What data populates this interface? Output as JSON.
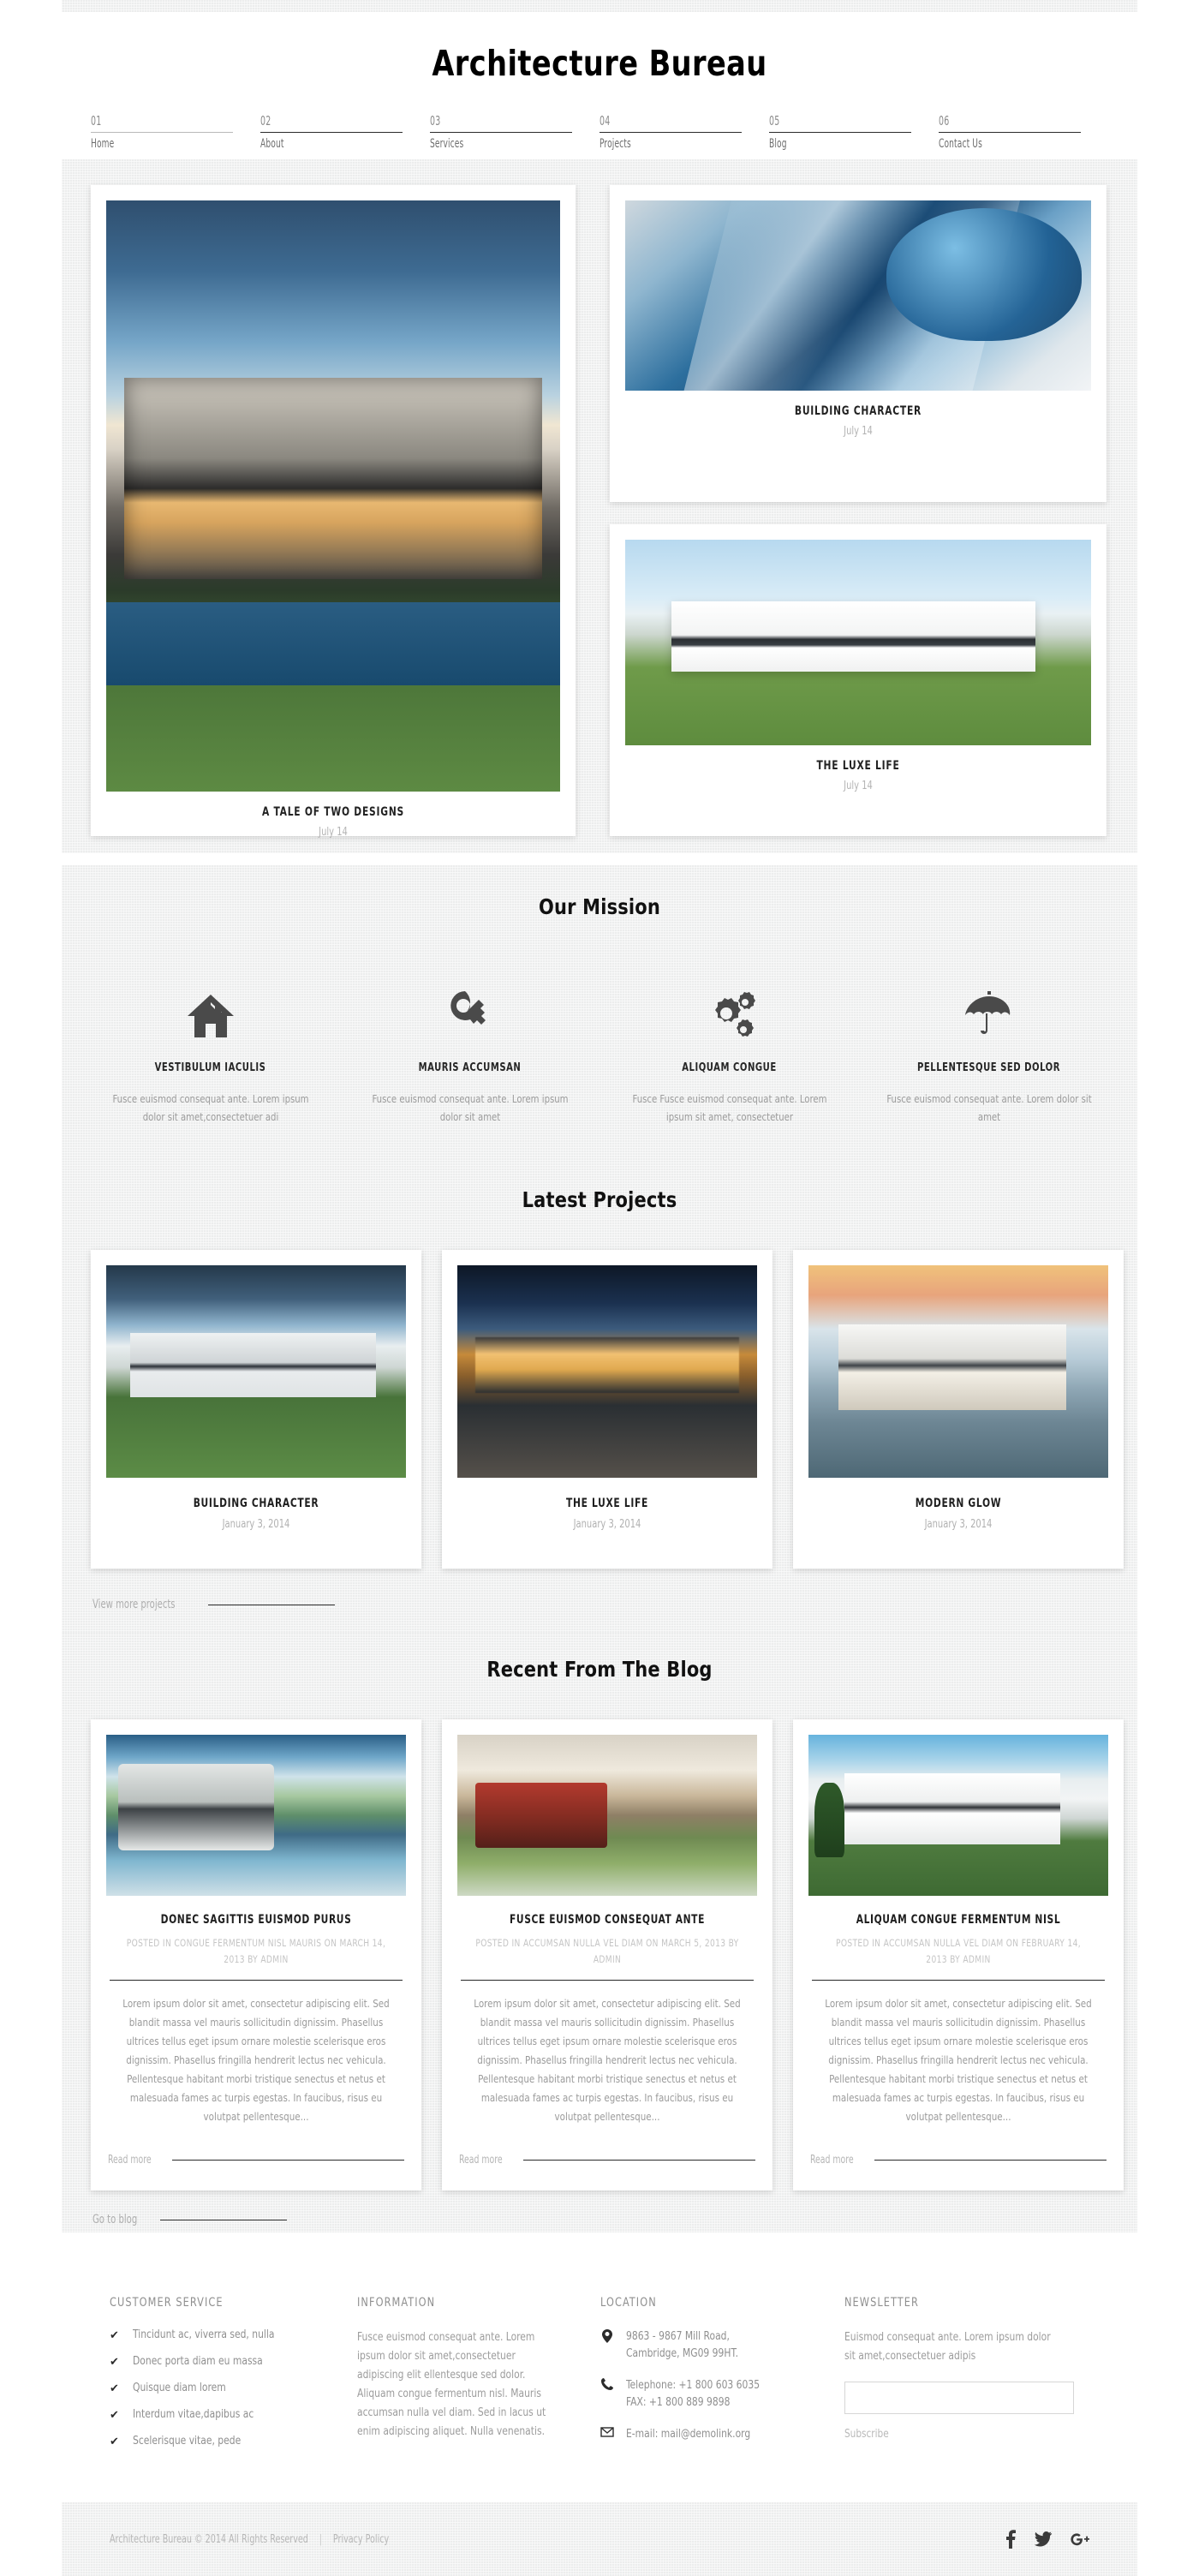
{
  "site": {
    "title": "Architecture Bureau"
  },
  "nav": {
    "items": [
      {
        "num": "01",
        "label": "Home",
        "active": true
      },
      {
        "num": "02",
        "label": "About",
        "active": false
      },
      {
        "num": "03",
        "label": "Services",
        "active": false
      },
      {
        "num": "04",
        "label": "Projects",
        "active": false
      },
      {
        "num": "05",
        "label": "Blog",
        "active": false
      },
      {
        "num": "06",
        "label": "Contact Us",
        "active": false
      }
    ]
  },
  "gallery": {
    "big": {
      "title": "A TALE OF TWO DESIGNS",
      "date": "July 14"
    },
    "top_right": {
      "title": "BUILDING CHARACTER",
      "date": "July 14"
    },
    "bottom_right": {
      "title": "THE LUXE LIFE",
      "date": "July 14"
    }
  },
  "mission": {
    "heading": "Our Mission",
    "items": [
      {
        "icon": "home-icon",
        "title": "VESTIBULUM IACULIS",
        "text": "Fusce euismod consequat ante. Lorem ipsum dolor sit amet,consectetuer adi"
      },
      {
        "icon": "key-icon",
        "title": "MAURIS ACCUMSAN",
        "text": "Fusce euismod consequat ante. Lorem ipsum dolor sit amet"
      },
      {
        "icon": "gears-icon",
        "title": "ALIQUAM CONGUE",
        "text": "Fusce Fusce euismod consequat ante. Lorem ipsum sit amet, consectetuer"
      },
      {
        "icon": "umbrella-icon",
        "title": "PELLENTESQUE SED DOLOR",
        "text": "Fusce euismod consequat ante. Lorem dolor sit amet"
      }
    ]
  },
  "projects": {
    "heading": "Latest Projects",
    "items": [
      {
        "title": "BUILDING CHARACTER",
        "date": "January 3, 2014"
      },
      {
        "title": "THE LUXE LIFE",
        "date": "January 3, 2014"
      },
      {
        "title": "MODERN GLOW",
        "date": "January 3, 2014"
      }
    ],
    "more_label": "View more projects"
  },
  "blog": {
    "heading": "Recent From The Blog",
    "posts": [
      {
        "title": "DONEC SAGITTIS EUISMOD PURUS",
        "meta": "POSTED IN CONGUE FERMENTUM NISL MAURIS ON MARCH 14, 2013 BY ADMIN",
        "body": "Lorem ipsum dolor sit amet, consectetur adipiscing elit. Sed blandit massa vel mauris sollicitudin dignissim. Phasellus ultrices tellus eget ipsum ornare molestie scelerisque eros dignissim. Phasellus fringilla hendrerit lectus nec vehicula. Pellentesque habitant morbi tristique senectus et netus et malesuada fames ac turpis egestas. In faucibus, risus eu volutpat pellentesque...",
        "read_more": "Read more"
      },
      {
        "title": "FUSCE EUISMOD CONSEQUAT ANTE",
        "meta": "POSTED IN ACCUMSAN NULLA VEL DIAM ON MARCH 5, 2013 BY ADMIN",
        "body": "Lorem ipsum dolor sit amet, consectetur adipiscing elit. Sed blandit massa vel mauris sollicitudin dignissim. Phasellus ultrices tellus eget ipsum ornare molestie scelerisque eros dignissim. Phasellus fringilla hendrerit lectus nec vehicula. Pellentesque habitant morbi tristique senectus et netus et malesuada fames ac turpis egestas. In faucibus, risus eu volutpat pellentesque...",
        "read_more": "Read more"
      },
      {
        "title": "ALIQUAM CONGUE FERMENTUM NISL",
        "meta": "POSTED IN ACCUMSAN NULLA VEL DIAM ON FEBRUARY 14, 2013 BY ADMIN",
        "body": "Lorem ipsum dolor sit amet, consectetur adipiscing elit. Sed blandit massa vel mauris sollicitudin dignissim. Phasellus ultrices tellus eget ipsum ornare molestie scelerisque eros dignissim. Phasellus fringilla hendrerit lectus nec vehicula. Pellentesque habitant morbi tristique senectus et netus et malesuada fames ac turpis egestas. In faucibus, risus eu volutpat pellentesque...",
        "read_more": "Read more"
      }
    ],
    "go_to_blog": "Go to blog"
  },
  "footer": {
    "customer_service": {
      "heading": "CUSTOMER SERVICE",
      "items": [
        "Tincidunt ac, viverra sed, nulla",
        "Donec porta diam eu massa",
        "Quisque diam lorem",
        "Interdum vitae,dapibus ac",
        "Scelerisque vitae, pede"
      ]
    },
    "information": {
      "heading": "INFORMATION",
      "text": "Fusce euismod consequat ante. Lorem ipsum dolor sit amet,consectetuer adipiscing elit ellentesque sed dolor. Aliquam congue fermentum nisl. Mauris accumsan nulla vel diam. Sed in lacus ut enim adipiscing aliquet. Nulla venenatis."
    },
    "location": {
      "heading": "LOCATION",
      "address_line1": "9863 - 9867 Mill Road,",
      "address_line2": "Cambridge, MG09 99HT.",
      "telephone": "Telephone: +1 800 603 6035",
      "fax": "FAX: +1 800 889 9898",
      "email": "E-mail: mail@demolink.org"
    },
    "newsletter": {
      "heading": "NEWSLETTER",
      "text": "Euismod consequat ante. Lorem ipsum dolor sit amet,consectetuer adipis",
      "input_value": "",
      "input_placeholder": "",
      "subscribe_label": "Subscribe"
    }
  },
  "copyright": {
    "text": "Architecture Bureau © 2014 All Rights Reserved",
    "separator": "|",
    "privacy": "Privacy Policy",
    "socials": [
      {
        "name": "facebook-icon",
        "glyph": "f"
      },
      {
        "name": "twitter-icon",
        "glyph": "t"
      },
      {
        "name": "googleplus-icon",
        "glyph": "g+"
      }
    ]
  }
}
